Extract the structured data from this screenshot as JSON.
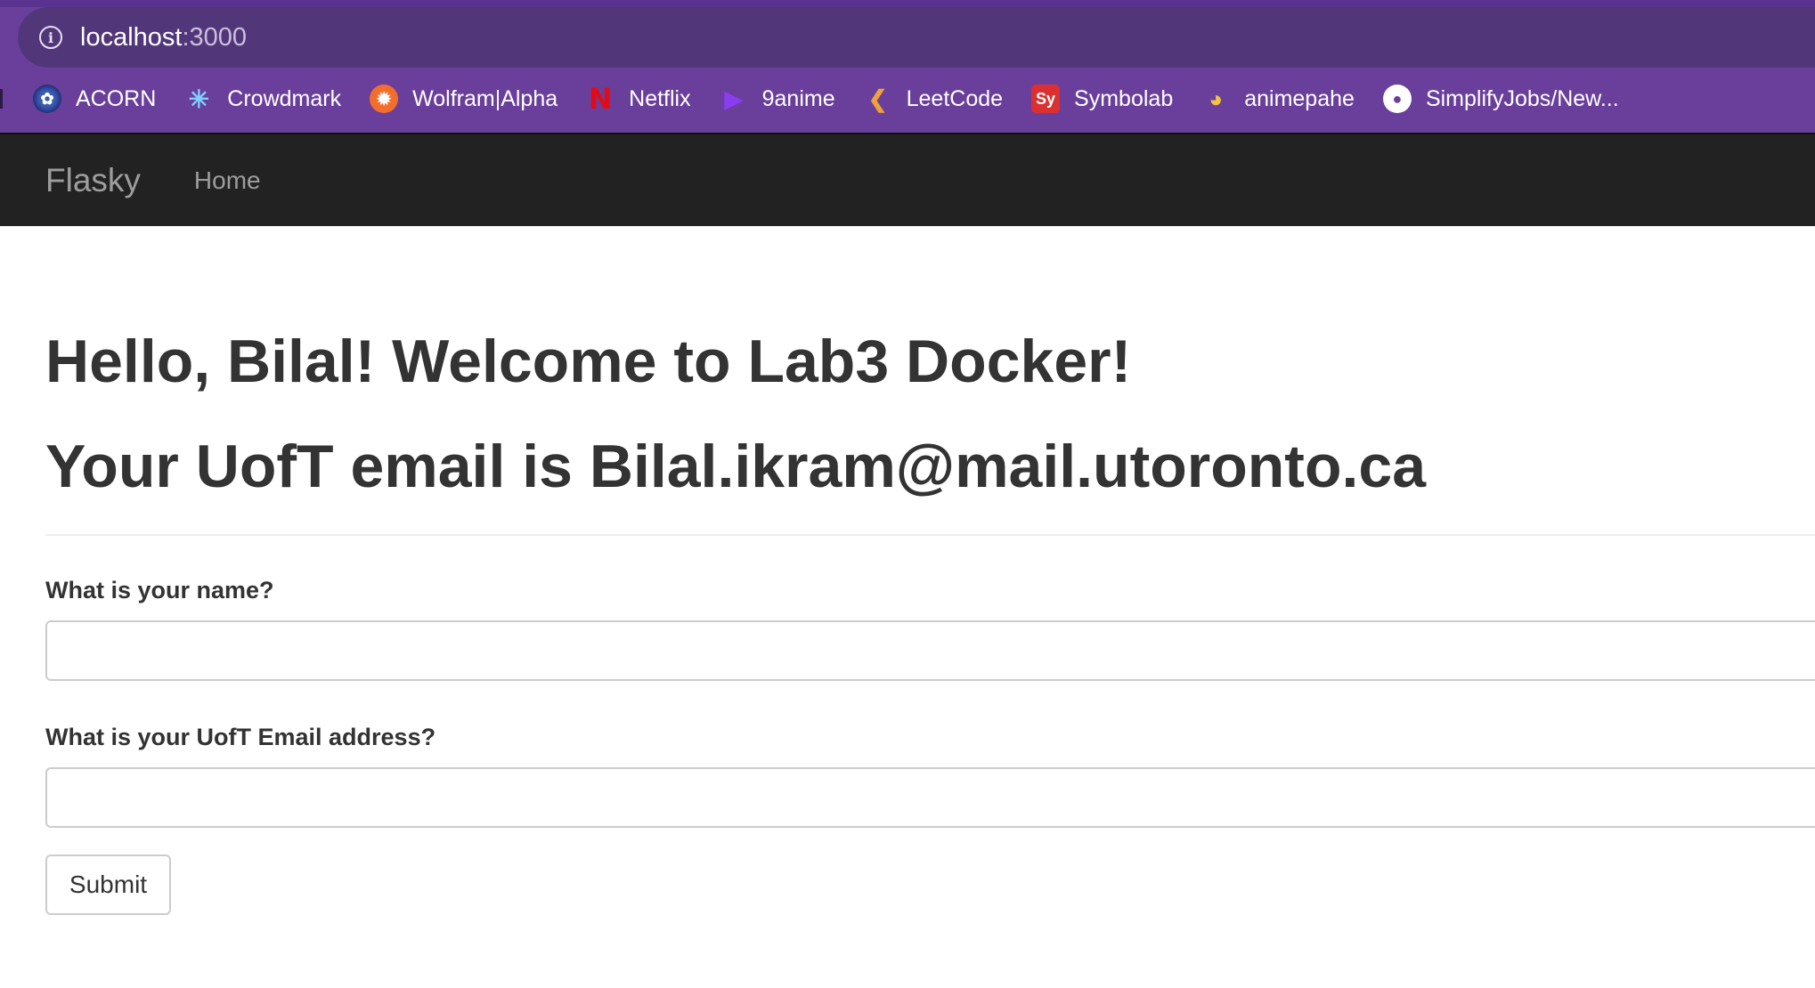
{
  "browser": {
    "url_host": "localhost",
    "url_port": ":3000",
    "bookmarks": [
      {
        "label": "ACORN",
        "icon": "acorn-icon"
      },
      {
        "label": "Crowdmark",
        "icon": "crowdmark-icon"
      },
      {
        "label": "Wolfram|Alpha",
        "icon": "wolframalpha-icon"
      },
      {
        "label": "Netflix",
        "icon": "netflix-icon"
      },
      {
        "label": "9anime",
        "icon": "9anime-icon"
      },
      {
        "label": "LeetCode",
        "icon": "leetcode-icon"
      },
      {
        "label": "Symbolab",
        "icon": "symbolab-icon"
      },
      {
        "label": "animepahe",
        "icon": "animepahe-icon"
      },
      {
        "label": "SimplifyJobs/New...",
        "icon": "github-icon"
      }
    ]
  },
  "navbar": {
    "brand": "Flasky",
    "home": "Home"
  },
  "main": {
    "greeting": "Hello, Bilal! Welcome to Lab3 Docker!",
    "email_line": "Your UofT email is Bilal.ikram@mail.utoronto.ca"
  },
  "form": {
    "name_label": "What is your name?",
    "name_value": "",
    "email_label": "What is your UofT Email address?",
    "email_value": "",
    "submit_label": "Submit"
  },
  "colors": {
    "chrome_bg": "#6a3f9c",
    "omnibox_bg": "#52367a",
    "navbar_bg": "#222222",
    "navbar_text": "#9d9d9d",
    "heading_text": "#333333"
  }
}
